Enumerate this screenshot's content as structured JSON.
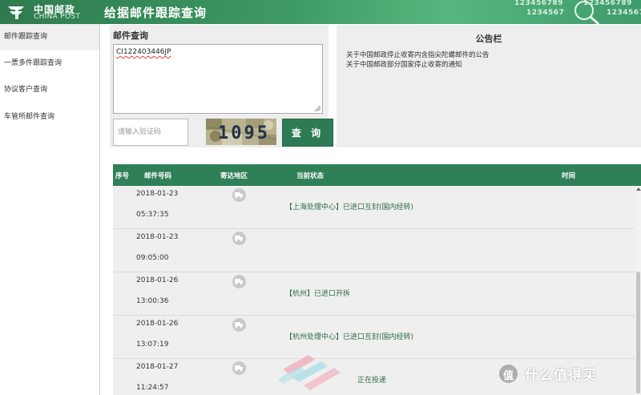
{
  "header": {
    "logo_cn": "中国邮政",
    "logo_en": "CHINA POST",
    "title": "给据邮件跟踪查询",
    "deco_numbers": [
      "123456789",
      "123456789",
      "1234567",
      "123456789"
    ]
  },
  "sidebar": {
    "items": [
      {
        "label": "邮件跟踪查询",
        "active": true
      },
      {
        "label": "一票多件跟踪查询",
        "active": false
      },
      {
        "label": "协议客户查询",
        "active": false
      },
      {
        "label": "车管所邮件查询",
        "active": false
      }
    ]
  },
  "query": {
    "title": "邮件查询",
    "tracking_number": "CI122403446JP",
    "captcha_placeholder": "请输入验证码",
    "captcha_code": "1095",
    "submit_label": "查 询"
  },
  "notice": {
    "title": "公告栏",
    "items": [
      "关于中国邮政停止收寄内含指尖陀螺邮件的公告",
      "关于中国邮政部分国家停止收寄的通知"
    ]
  },
  "table": {
    "headers": {
      "seq": "序号",
      "mail_no": "邮件号码",
      "area": "寄达地区",
      "status": "当前状态",
      "time": "时间"
    },
    "rows": [
      {
        "date": "2018-01-23",
        "time": "05:37:35",
        "status": "【上海处理中心】已进口互封(国内经转)"
      },
      {
        "date": "2018-01-23",
        "time": "09:05:00",
        "status": ""
      },
      {
        "date": "2018-01-26",
        "time": "13:00:36",
        "status": "【杭州】已进口开拆"
      },
      {
        "date": "2018-01-26",
        "time": "13:07:19",
        "status": "【杭州处理中心】已进口互封(国内经转)"
      },
      {
        "date": "2018-01-27",
        "time": "11:24:57",
        "status": "正在投递"
      }
    ]
  },
  "watermark": {
    "text": "什么值得买",
    "circle_char": "值"
  },
  "colors": {
    "brand_green": "#2f7f58",
    "header_green": "#3e9a63",
    "status_green": "#2b6b45"
  }
}
